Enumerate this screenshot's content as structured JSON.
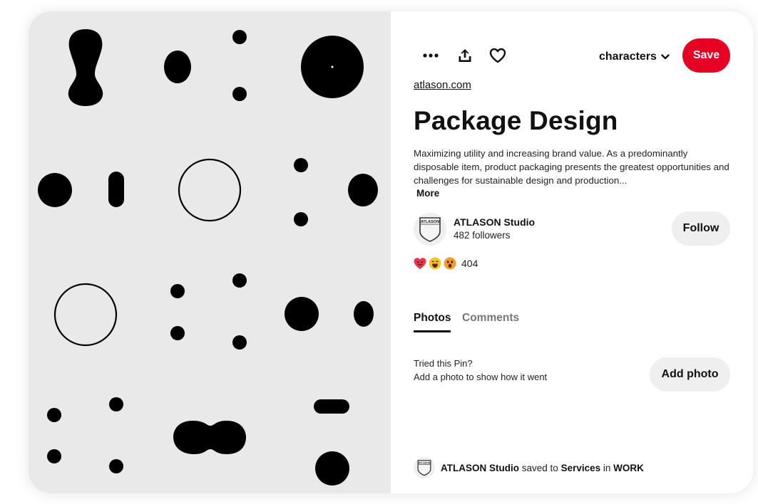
{
  "toolbar": {
    "more_icon": "more-horizontal-icon",
    "share_icon": "share-upload-icon",
    "like_icon": "heart-icon"
  },
  "board_select": {
    "label": "characters",
    "icon": "chevron-down-icon"
  },
  "save_button": {
    "label": "Save",
    "color": "#e60023"
  },
  "pin": {
    "source": "atlason.com",
    "title": "Package Design",
    "description": "Maximizing utility and increasing brand value. As a predominantly disposable item, product packaging presents the greatest opportunities and challenges for sustainable design and production...",
    "more_label": "More"
  },
  "author": {
    "name": "ATLASON Studio",
    "followers": "482 followers",
    "avatar_logo_text": "ATLASON"
  },
  "follow_button": {
    "label": "Follow"
  },
  "reactions": {
    "icons": [
      "heart-face-icon",
      "laugh-face-icon",
      "wow-face-icon"
    ],
    "count": "404"
  },
  "tabs": [
    {
      "label": "Photos",
      "active": true
    },
    {
      "label": "Comments",
      "active": false
    }
  ],
  "tried": {
    "title": "Tried this Pin?",
    "subtitle": "Add a photo to show how it went",
    "button_label": "Add photo"
  },
  "saved": {
    "user": "ATLASON Studio",
    "text1": "saved to",
    "board": "Services",
    "text2": "in",
    "section": "WORK"
  },
  "colors": {
    "accent": "#e60023",
    "image_bg": "#e9e9e9",
    "button_gray": "#efefef"
  }
}
